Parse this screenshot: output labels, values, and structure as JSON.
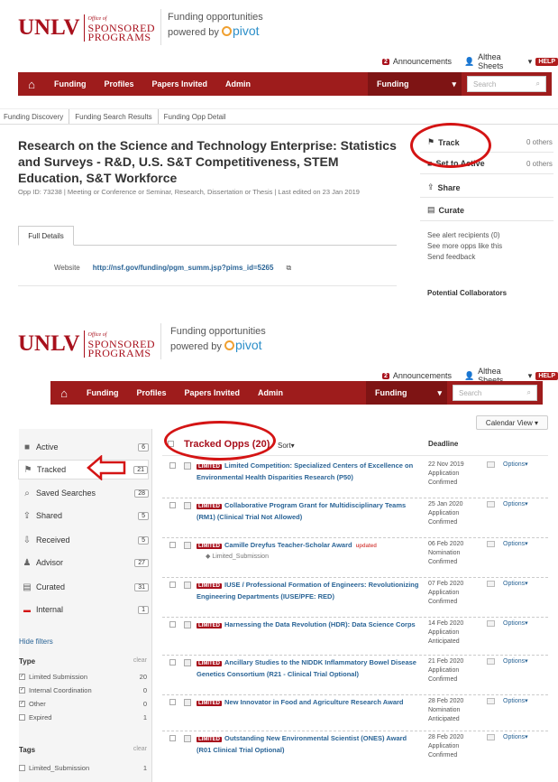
{
  "header": {
    "logo_text": "UNLV",
    "logo_office_of": "Office of",
    "logo_line1": "SPONSORED",
    "logo_line2": "PROGRAMS",
    "tagline1": "Funding opportunities",
    "tagline2": "powered by",
    "pivot": "pivot",
    "announcements_count": "2",
    "announcements": "Announcements",
    "user": "Althea Sheets",
    "help": "HELP"
  },
  "nav": {
    "items": [
      "Funding",
      "Profiles",
      "Papers Invited",
      "Admin"
    ],
    "dropdown": "Funding",
    "search_placeholder": "Search"
  },
  "detail": {
    "breadcrumb": [
      "Funding Discovery",
      "Funding Search Results",
      "Funding Opp Detail"
    ],
    "title": "Research on the Science and Technology Enterprise: Statistics and Surveys - R&D, U.S. S&T Competitiveness, STEM Education, S&T Workforce",
    "meta": "Opp ID: 73238  |  Meeting or Conference or Seminar, Research, Dissertation or Thesis  |  Last edited on 23 Jan 2019",
    "tab": "Full Details",
    "website_label": "Website",
    "website_url": "http://nsf.gov/funding/pgm_summ.jsp?pims_id=5265",
    "actions": {
      "track": "Track",
      "track_others": "0 others",
      "set_active": "Set to Active",
      "set_active_others": "0 others",
      "share": "Share",
      "curate": "Curate"
    },
    "links": [
      "See alert recipients  (0)",
      "See more opps like this",
      "Send feedback"
    ],
    "potential": "Potential Collaborators"
  },
  "tracked": {
    "calendar_view": "Calendar View",
    "heading": "Tracked Opps (20)",
    "sort": "Sort",
    "deadline_header": "Deadline",
    "sidebar": [
      {
        "label": "Active",
        "count": "6",
        "icon": "active-icon"
      },
      {
        "label": "Tracked",
        "count": "21",
        "icon": "flag-icon"
      },
      {
        "label": "Saved Searches",
        "count": "28",
        "icon": "search-icon"
      },
      {
        "label": "Shared",
        "count": "5",
        "icon": "share-icon"
      },
      {
        "label": "Received",
        "count": "5",
        "icon": "received-icon"
      },
      {
        "label": "Advisor",
        "count": "27",
        "icon": "advisor-icon"
      },
      {
        "label": "Curated",
        "count": "31",
        "icon": "curate-icon"
      },
      {
        "label": "Internal",
        "count": "1",
        "icon": "internal-icon"
      }
    ],
    "hide_filters": "Hide filters",
    "type_label": "Type",
    "clear": "clear",
    "types": [
      {
        "label": "Limited Submission",
        "count": "20",
        "checked": true
      },
      {
        "label": "Internal Coordination",
        "count": "0",
        "checked": true
      },
      {
        "label": "Other",
        "count": "0",
        "checked": true
      },
      {
        "label": "Expired",
        "count": "1",
        "checked": false
      }
    ],
    "tags_label": "Tags",
    "tags": [
      {
        "label": "Limited_Submission",
        "count": "1"
      }
    ],
    "rows": [
      {
        "limited": "LIMITED",
        "title": "Limited Competition: Specialized Centers of Excellence on Environmental Health Disparities Research (P50)",
        "date": "22 Nov 2019",
        "stage": "Application",
        "status": "Confirmed",
        "options": "Options"
      },
      {
        "limited": "LIMITED",
        "title": "Collaborative Program Grant for Multidisciplinary Teams (RM1) (Clinical Trial Not Allowed)",
        "date": "25 Jan 2020",
        "stage": "Application",
        "status": "Confirmed",
        "options": "Options"
      },
      {
        "limited": "LIMITED",
        "title": "Camille Dreyfus Teacher-Scholar Award",
        "updated": "updated",
        "tag": "Limited_Submission",
        "date": "06 Feb 2020",
        "stage": "Nomination",
        "status": "Confirmed",
        "options": "Options"
      },
      {
        "limited": "LIMITED",
        "title": "IUSE / Professional Formation of Engineers: Revolutionizing Engineering Departments (IUSE/PFE: RED)",
        "date": "07 Feb 2020",
        "stage": "Application",
        "status": "Confirmed",
        "options": "Options"
      },
      {
        "limited": "LIMITED",
        "title": "Harnessing the Data Revolution (HDR): Data Science Corps",
        "date": "14 Feb 2020",
        "stage": "Application",
        "status": "Anticipated",
        "options": "Options"
      },
      {
        "limited": "LIMITED",
        "title": "Ancillary Studies to the NIDDK Inflammatory Bowel Disease Genetics Consortium (R21 - Clinical Trial Optional)",
        "date": "21 Feb 2020",
        "stage": "Application",
        "status": "Confirmed",
        "options": "Options"
      },
      {
        "limited": "LIMITED",
        "title": "New Innovator in Food and Agriculture Research Award",
        "date": "28 Feb 2020",
        "stage": "Nomination",
        "status": "Anticipated",
        "options": "Options"
      },
      {
        "limited": "LIMITED",
        "title": "Outstanding New Environmental Scientist (ONES) Award (R01 Clinical Trial Optional)",
        "date": "28 Feb 2020",
        "stage": "Application",
        "status": "Confirmed",
        "options": "Options"
      }
    ]
  }
}
